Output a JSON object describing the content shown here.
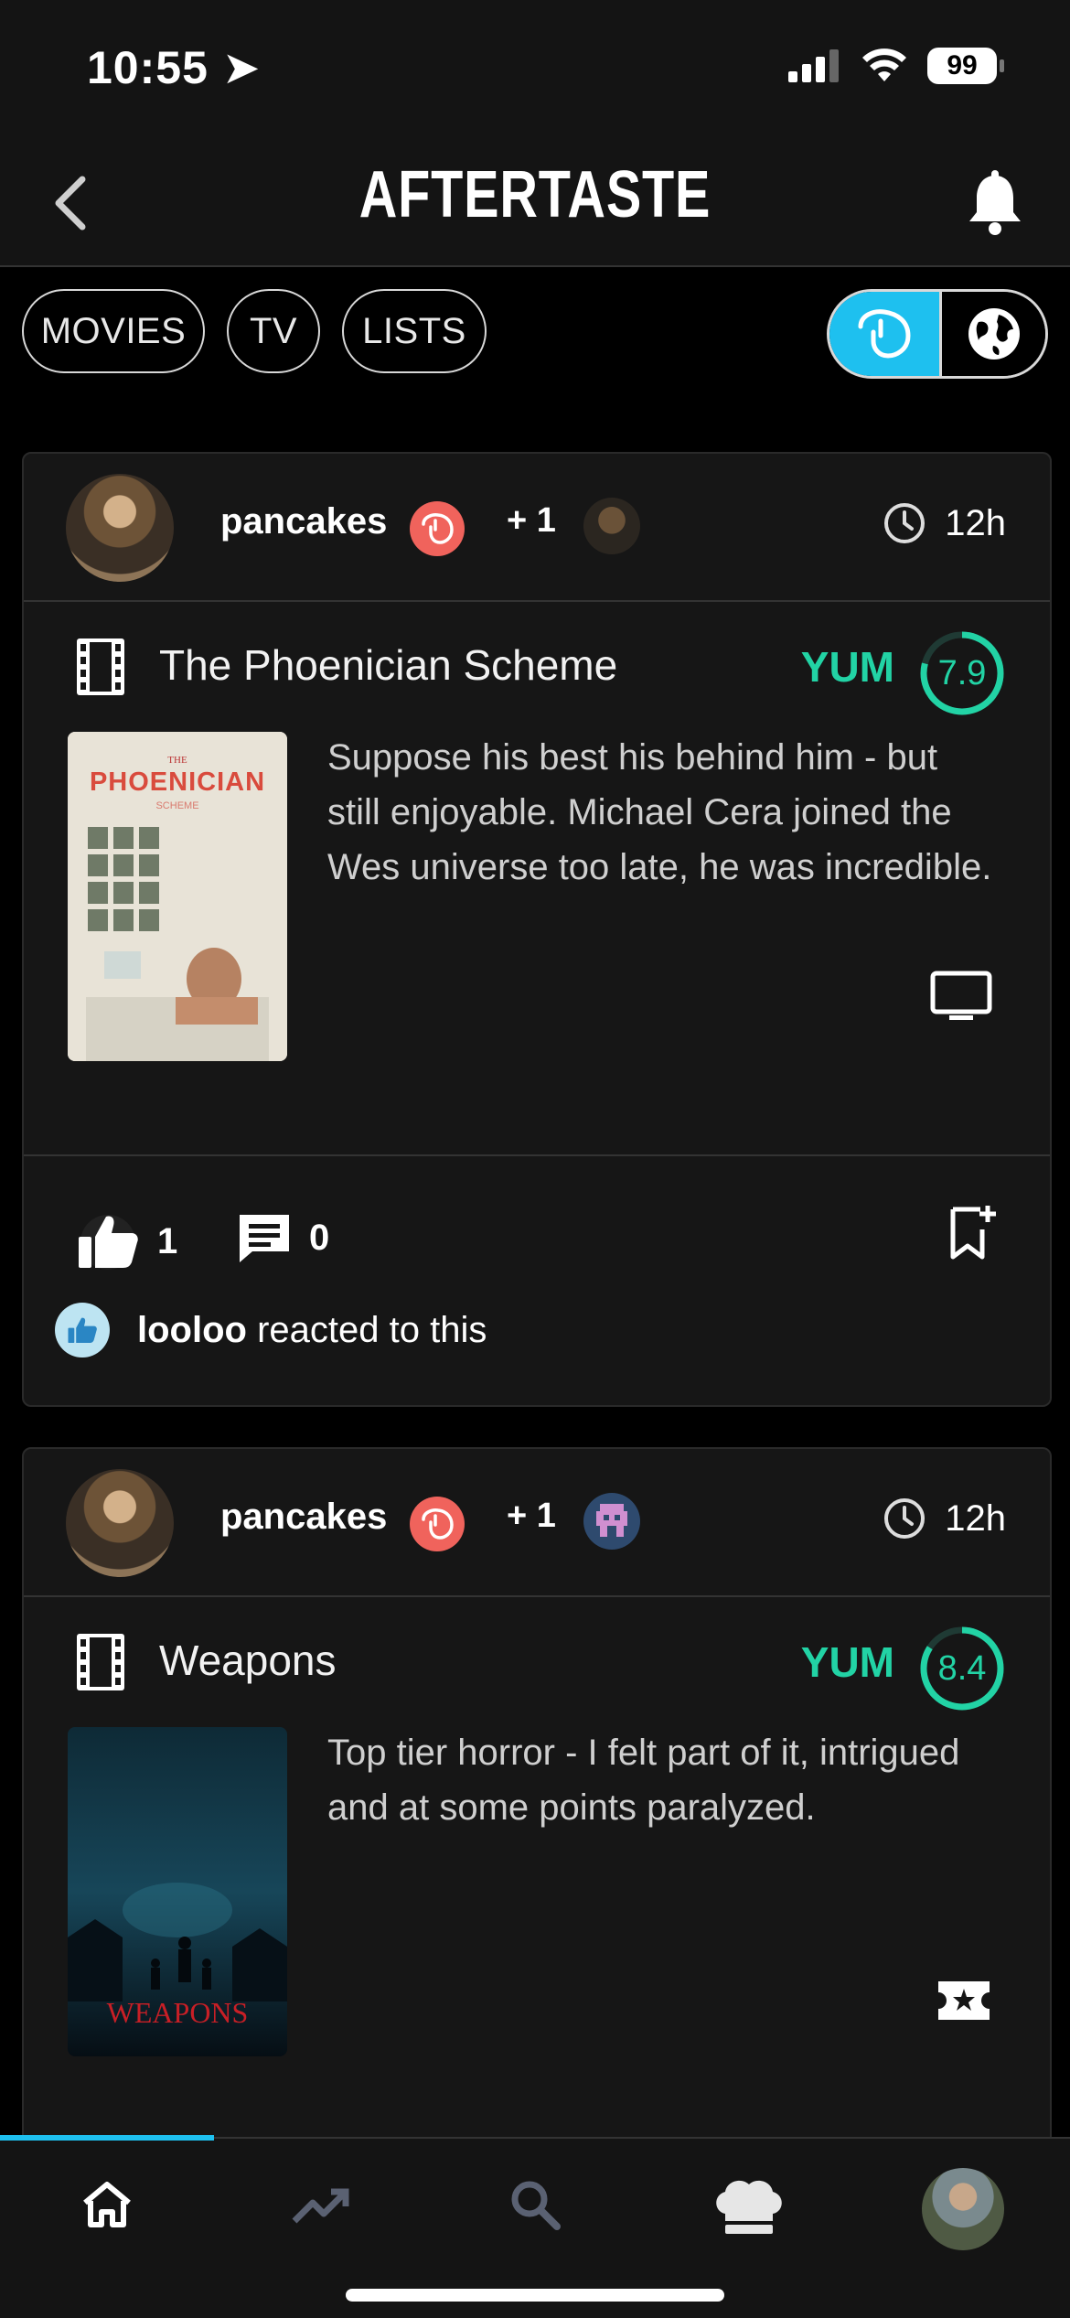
{
  "status": {
    "time": "10:55",
    "battery": "99"
  },
  "header": {
    "title": "AFTERTASTE"
  },
  "filters": {
    "movies": "MOVIES",
    "tv": "TV",
    "lists": "LISTS"
  },
  "posts": [
    {
      "username": "pancakes",
      "plus": "+ 1",
      "time_ago": "12h",
      "title": "The Phoenician Scheme",
      "verdict": "YUM",
      "score": "7.9",
      "score_fraction": 0.79,
      "review": "Suppose his best his behind him - but still enjoyable. Michael Cera joined the Wes universe too late, he was incredible.",
      "likes": "1",
      "comments": "0",
      "reactor": "looloo",
      "reaction_text": " reacted to this",
      "poster": {
        "the": "THE",
        "name": "PHOENICIAN",
        "sub": "SCHEME"
      }
    },
    {
      "username": "pancakes",
      "plus": "+ 1",
      "time_ago": "12h",
      "title": "Weapons",
      "verdict": "YUM",
      "score": "8.4",
      "score_fraction": 0.84,
      "review": "Top tier horror - I felt part of it, intrigued and at some points paralyzed.",
      "poster": {
        "name": "WEAPONS"
      }
    }
  ]
}
